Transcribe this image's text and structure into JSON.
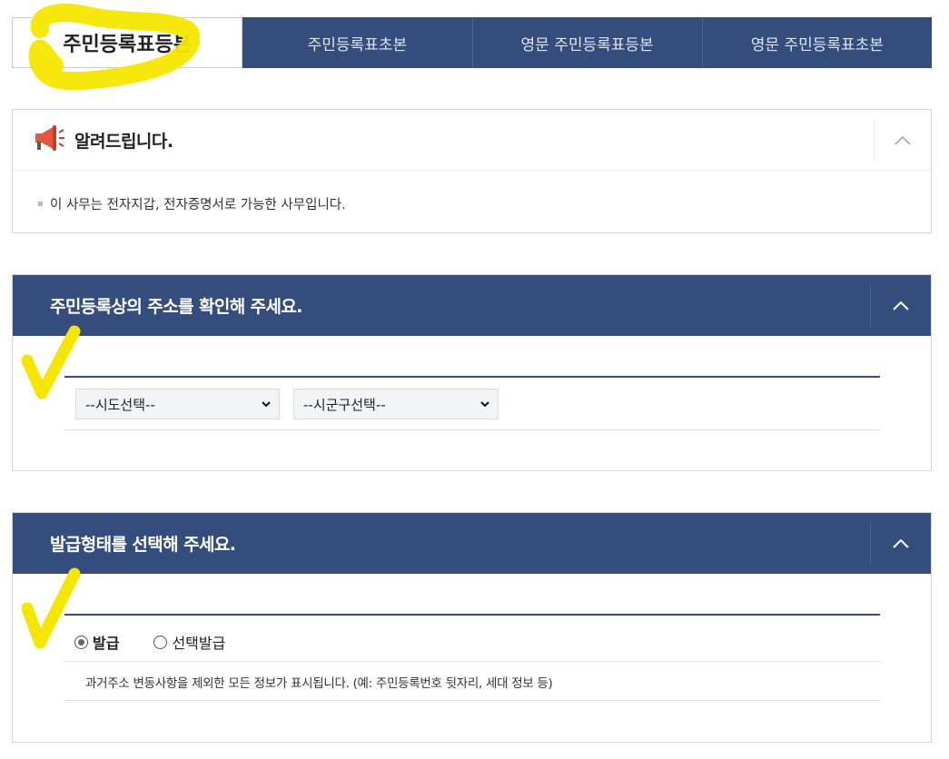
{
  "tabs": [
    {
      "label": "주민등록표등본",
      "active": true
    },
    {
      "label": "주민등록표초본",
      "active": false
    },
    {
      "label": "영문 주민등록표등본",
      "active": false
    },
    {
      "label": "영문 주민등록표초본",
      "active": false
    }
  ],
  "notice": {
    "icon": "megaphone-icon",
    "title": "알려드립니다.",
    "items": [
      "이 사무는 전자지갑, 전자증명서로 가능한 사무입니다."
    ]
  },
  "address_section": {
    "title": "주민등록상의 주소를 확인해 주세요.",
    "sido_select": {
      "value": "--시도선택--"
    },
    "sigungu_select": {
      "value": "--시군구선택--"
    }
  },
  "issue_section": {
    "title": "발급형태를 선택해 주세요.",
    "options": [
      {
        "label": "발급",
        "selected": true
      },
      {
        "label": "선택발급",
        "selected": false
      }
    ],
    "description": "과거주소 변동사항을 제외한 모든 정보가 표시됩니다. (예: 주민등록번호 뒷자리, 세대 정보 등)"
  },
  "colors": {
    "primary_navy": "#344d7c",
    "highlight_yellow": "#f5e600"
  }
}
